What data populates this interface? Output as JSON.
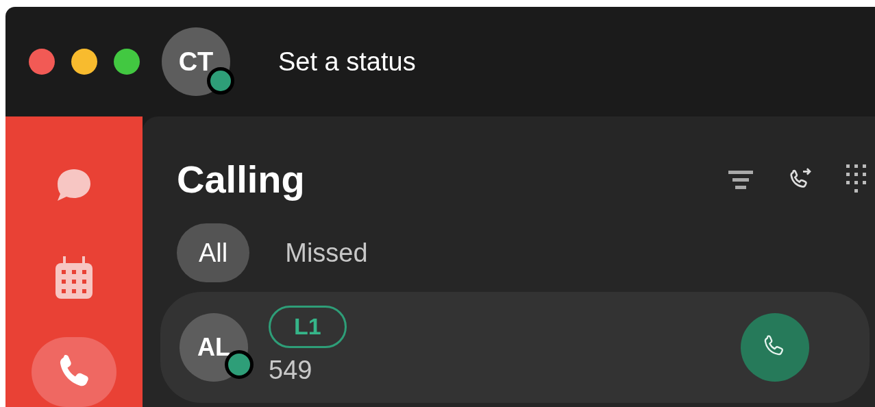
{
  "user": {
    "initials": "CT",
    "available": true
  },
  "status_prompt": "Set a status",
  "sidebar": {
    "items": [
      {
        "kind": "chat",
        "selected": false
      },
      {
        "kind": "calendar",
        "selected": false
      },
      {
        "kind": "phone",
        "selected": true
      }
    ]
  },
  "title": "Calling",
  "tabs": [
    {
      "label": "All",
      "selected": true
    },
    {
      "label": "Missed",
      "selected": false
    }
  ],
  "calls": [
    {
      "initials": "AL",
      "available": true,
      "line": "L1",
      "number": "549"
    }
  ]
}
